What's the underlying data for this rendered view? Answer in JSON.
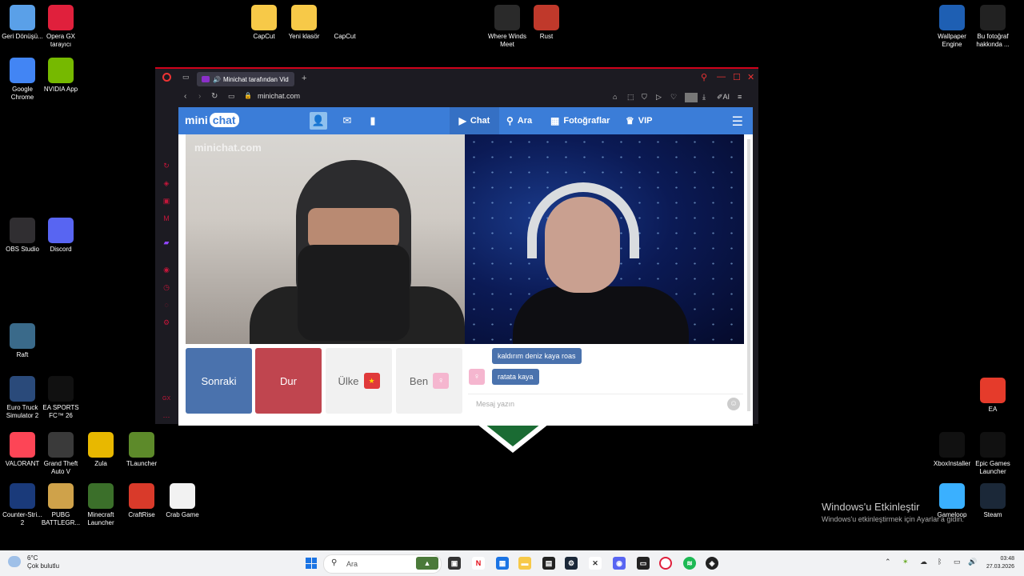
{
  "desktop": {
    "icons_left": [
      {
        "label": "Geri Dönüşü...",
        "color": "#5aa0e8"
      },
      {
        "label": "Opera GX tarayıcı",
        "color": "#e0203c"
      },
      {
        "label": "Google Chrome",
        "color": "#4285f4"
      },
      {
        "label": "NVIDIA App",
        "color": "#76b900"
      },
      {
        "label": "OBS Studio",
        "color": "#302e31"
      },
      {
        "label": "Discord",
        "color": "#5865f2"
      },
      {
        "label": "Raft",
        "color": "#3a6a8a"
      },
      {
        "label": "Euro Truck Simulator 2",
        "color": "#2a4a7a"
      },
      {
        "label": "EA SPORTS FC™ 26",
        "color": "#111111"
      },
      {
        "label": "VALORANT",
        "color": "#fd4556"
      },
      {
        "label": "Grand Theft Auto V",
        "color": "#3a3a3a"
      },
      {
        "label": "Zula",
        "color": "#e8b800"
      },
      {
        "label": "TLauncher",
        "color": "#5d8a2a"
      },
      {
        "label": "Counter-Stri... 2",
        "color": "#1a3a7a"
      },
      {
        "label": "PUBG BATTLEGR...",
        "color": "#cfa24a"
      },
      {
        "label": "Minecraft Launcher",
        "color": "#3b6f2a"
      },
      {
        "label": "CraftRise",
        "color": "#d93a2a"
      },
      {
        "label": "Crab Game",
        "color": "#f2f2f2"
      }
    ],
    "icons_top": [
      {
        "label": "CapCut",
        "color": "#f7c948"
      },
      {
        "label": "Yeni klasör",
        "color": "#f7c948"
      },
      {
        "label": "CapCut",
        "color": "#000000"
      },
      {
        "label": "Where Winds Meet",
        "color": "#2a2a2a"
      },
      {
        "label": "Rust",
        "color": "#c0392b"
      }
    ],
    "icons_right": [
      {
        "label": "Wallpaper Engine",
        "color": "#1e5fb3"
      },
      {
        "label": "Bu fotoğraf hakkında ...",
        "color": "#222222"
      },
      {
        "label": "EA",
        "color": "#e53b2b"
      },
      {
        "label": "XboxInstaller",
        "color": "#111111"
      },
      {
        "label": "Epic Games Launcher",
        "color": "#111111"
      },
      {
        "label": "Gameloop",
        "color": "#3ab0ff"
      },
      {
        "label": "Steam",
        "color": "#1b2838"
      }
    ],
    "watermark_title": "Windows'u Etkinleştir",
    "watermark_sub": "Windows'u etkinleştirmek için Ayarlar'a gidin."
  },
  "browser": {
    "tab_title": "Minichat tarafından Vid",
    "url": "minichat.com",
    "accent": "#d0021b"
  },
  "site": {
    "logo_mini": "mini",
    "logo_chat": "chat",
    "nav": {
      "chat": "Chat",
      "search": "Ara",
      "photos": "Fotoğraflar",
      "vip": "VIP"
    },
    "video_watermark": "minichat.com",
    "buttons": {
      "next": "Sonraki",
      "stop": "Dur",
      "country": "Ülke",
      "me": "Ben"
    },
    "messages": [
      "kaldırım deniz kaya roas",
      "ratata kaya"
    ],
    "message_placeholder": "Mesaj yazın",
    "brand_color": "#3b7dd8"
  },
  "taskbar": {
    "weather_temp": "6°C",
    "weather_desc": "Çok bulutlu",
    "search_placeholder": "Ara",
    "time": "03:48",
    "date": "27.03.2026"
  }
}
